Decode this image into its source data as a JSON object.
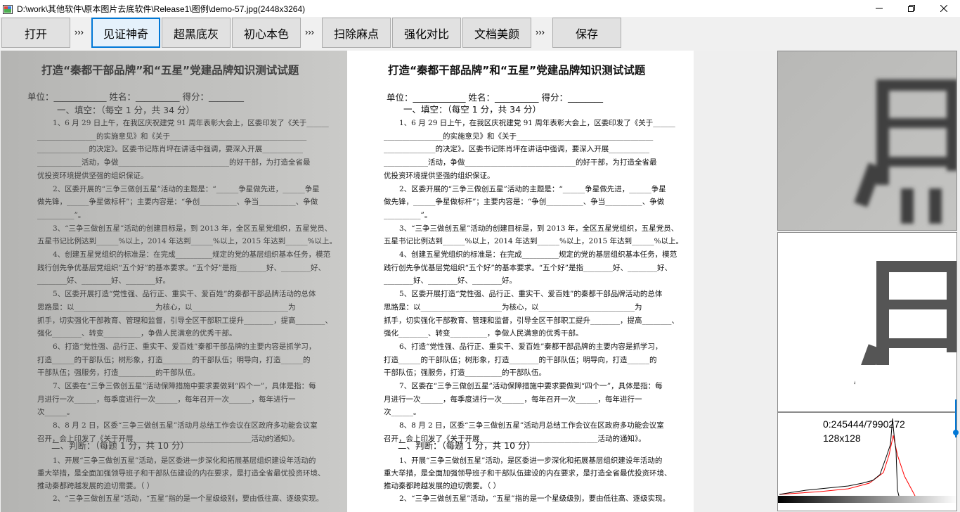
{
  "window": {
    "title": "D:\\work\\其他软件\\原本图片去底软件\\Release1\\图例\\demo-57.jpg(2448x3264)"
  },
  "toolbar": {
    "buttons": [
      {
        "label": "打开"
      },
      {
        "label": "见证神奇"
      },
      {
        "label": "超黑底灰"
      },
      {
        "label": "初心本色"
      },
      {
        "label": "扫除麻点"
      },
      {
        "label": "强化对比"
      },
      {
        "label": "文档美颜"
      },
      {
        "label": "保存"
      }
    ],
    "separator": "›››"
  },
  "document": {
    "title": "打造“秦都干部品牌”和“五星”党建品牌知识测试试题",
    "header": "单位：____________        姓名：__________        得分：________",
    "section1": "一、填空：（每空 1 分，共 34 分）",
    "lines": [
      "1、6 月 29 日上午，在我区庆祝建党 91 周年表彰大会上，区委印发了《关于______",
      "________________的实施意见》和《关于_____________________________________",
      "______________的决定》。区委书记陈肖坪在讲话中强调，要深入开展___________",
      "____________活动，争做______________________________的好干部，为打造全省最",
      "优投资环境提供坚强的组织保证。",
      "2、区委开展的“三争三做创五星”活动的主题是：“______争星做先进，______争星",
      "做先锋，______争星做标杆”；主要内容是：“争创__________、争当__________、争做",
      "__________”。",
      "3、“三争三做创五星”活动的创建目标是，到 2013 年，全区五星党组织，五星党员、",
      "五星书记比例达到______%以上，2014 年达到______%以上，2015 年达到______%以上。",
      "4、创建五星党组织的标准是：在完成__________规定的党的基层组织基本任务，模范",
      "践行创先争优基层党组织“五个好”的基本要求。“五个好”是指________好、________好、",
      "________好、________好、________好。",
      "5、区委开展打造“党性强、品行正、重实干、爱百姓”的秦都干部品牌活动的总体",
      "思路是：以______________________为核心，以__________________________为",
      "抓手，切实强化干部教育、管理和监督，引导全区干部职工提升________，提高________、",
      "强化________、转变__________，争做人民满意的优秀干部。",
      "6、打造“党性强、品行正、重实干、爱百姓”秦都干部品牌的主要内容是抓学习，",
      "打造______的干部队伍；树形象，打造________的干部队伍；明导向，打造______的",
      "干部队伍；强服务，打造__________的干部队伍。",
      "7、区委在“三争三做创五星”活动保障措施中要求要做到“四个一”，具体是指：每",
      "月进行一次______，每季度进行一次______，每年召开一次______，每年进行一",
      "次______。",
      "8、8 月 2 日，区委“三争三做创五星”活动月总结工作会议在区政府多功能会议室",
      "召开，会上印发了《关于开展________________________________活动的通知》。"
    ],
    "section2": "二、判断：（每题 1 分，共 10 分）",
    "lines2": [
      "1、开展“三争三做创五星”活动，是区委进一步深化和拓展基层组织建设年活动的",
      "重大举措，是全面加强领导班子和干部队伍建设的内在要求，是打造全省最优投资环境、",
      "推动秦都跨越发展的迫切需要。（  ）",
      "2、“三争三做创五星”活动，“五星”指的是一个星级级别，要由低往高、逐级实现。"
    ]
  },
  "side_panels": {
    "zoom_original_label": "",
    "zoom_enhanced_label": "",
    "histogram": {
      "count_text": "0:245444/7990272",
      "size_text": "128x128"
    }
  },
  "colors": {
    "toolbar_bg": "#f0f0f0",
    "button_bg": "#e1e1e1",
    "active_border": "#0078d7",
    "hist_fit": "#ff0000",
    "hist_curve": "#000000"
  }
}
